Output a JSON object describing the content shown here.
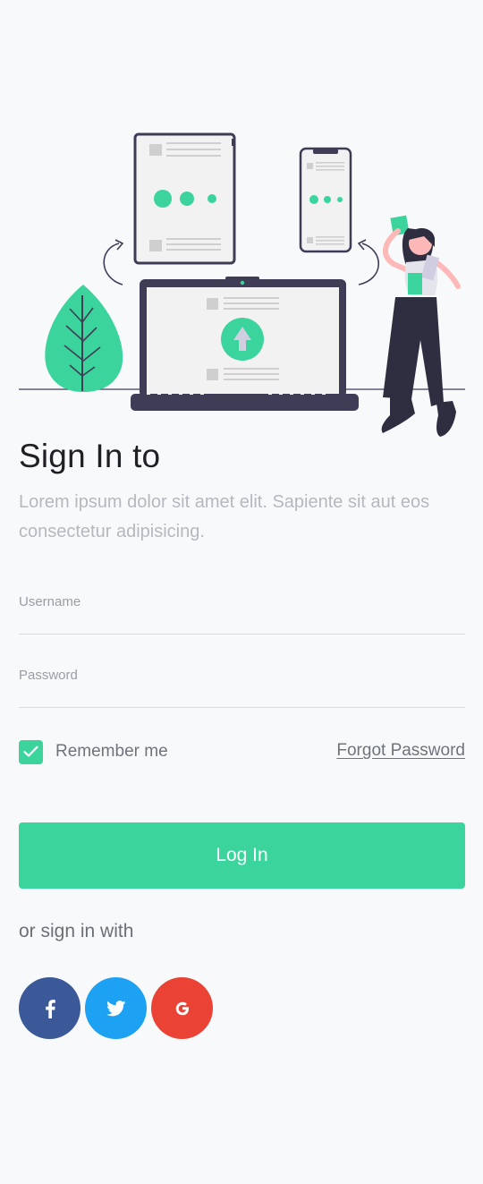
{
  "header": {
    "title": "Sign In to",
    "subtitle": "Lorem ipsum dolor sit amet elit. Sapiente sit aut eos consectetur adipisicing."
  },
  "form": {
    "username_label": "Username",
    "password_label": "Password",
    "remember_label": "Remember me",
    "remember_checked": true,
    "forgot_label": "Forgot Password",
    "login_label": "Log In"
  },
  "social": {
    "prompt": "or sign in with",
    "buttons": [
      {
        "name": "facebook",
        "icon": "facebook-icon",
        "color": "#3b5998"
      },
      {
        "name": "twitter",
        "icon": "twitter-icon",
        "color": "#1da1f2"
      },
      {
        "name": "google",
        "icon": "google-icon",
        "color": "#ea4335"
      }
    ]
  },
  "colors": {
    "accent": "#3ad49c",
    "dark": "#3f3d56",
    "background": "#f8f9fb"
  }
}
